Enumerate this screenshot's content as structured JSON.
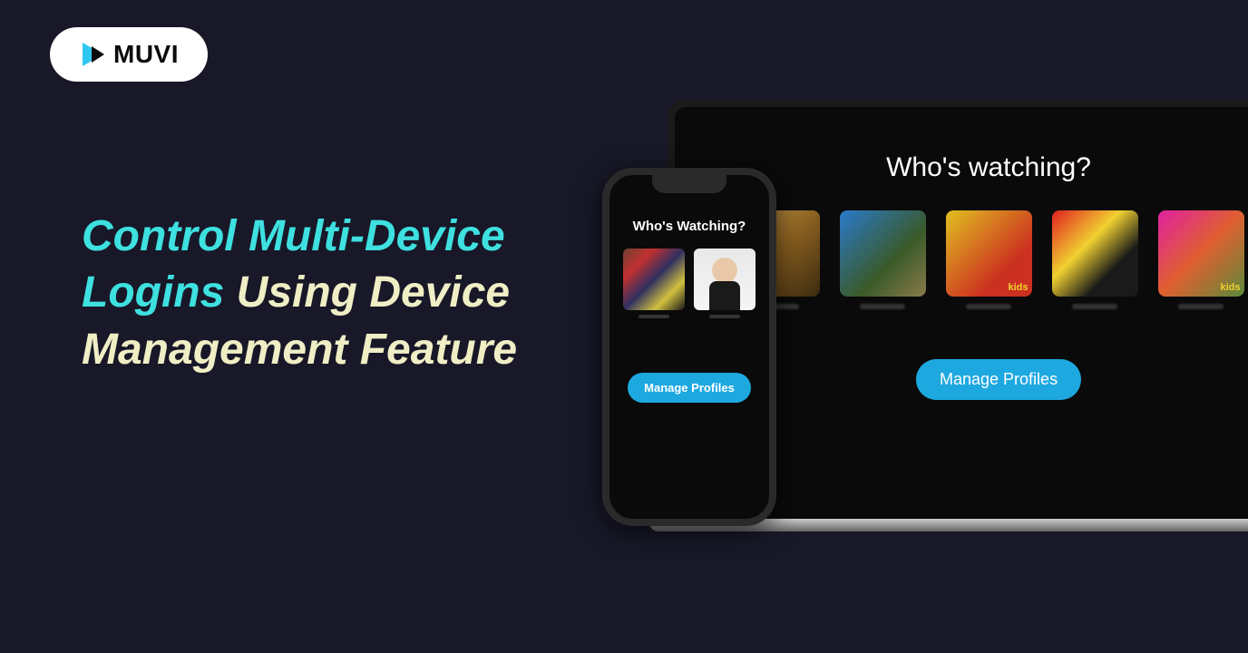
{
  "logo": {
    "text": "MUVI"
  },
  "headline": {
    "line1": "Control Multi-Device",
    "line2a": "Logins",
    "line2b": "Using Device",
    "line3": "Management Feature"
  },
  "laptop": {
    "title": "Who's watching?",
    "profiles": [
      {
        "id": "tiger",
        "kids": false
      },
      {
        "id": "turtle",
        "kids": false
      },
      {
        "id": "bug",
        "kids": true
      },
      {
        "id": "mickey",
        "kids": false
      },
      {
        "id": "butterfly",
        "kids": true
      }
    ],
    "manage_label": "Manage Profiles",
    "kids_label": "kids"
  },
  "phone": {
    "title": "Who's Watching?",
    "profiles": [
      {
        "id": "characters"
      },
      {
        "id": "figure"
      }
    ],
    "manage_label": "Manage Profiles"
  }
}
